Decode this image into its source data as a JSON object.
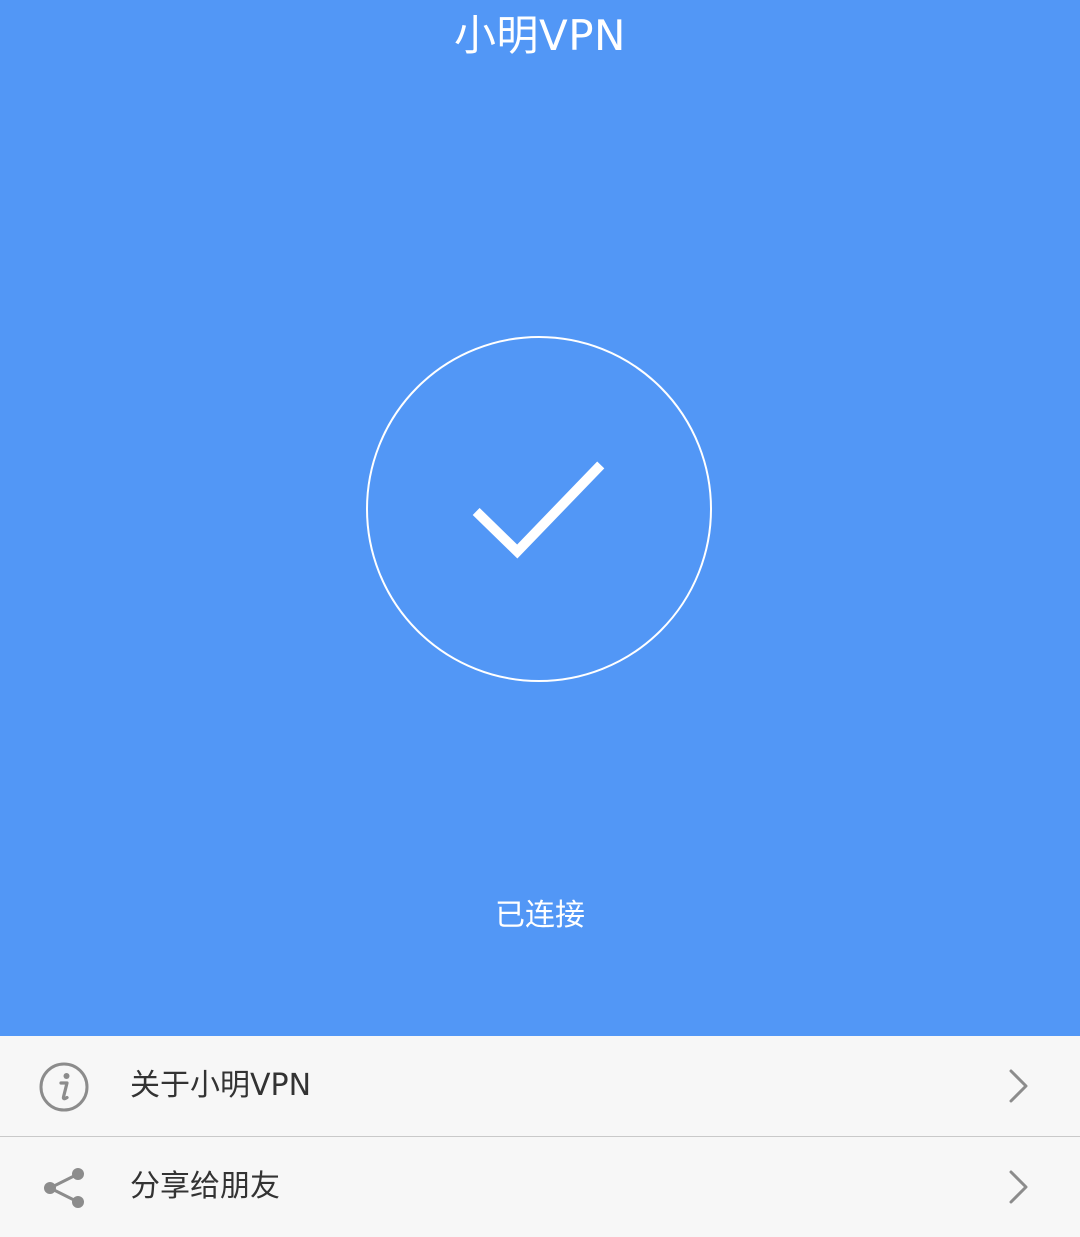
{
  "header": {
    "title": "小明VPN"
  },
  "status": {
    "text": "已连接",
    "icon": "checkmark-icon"
  },
  "menu": {
    "items": [
      {
        "label": "关于小明VPN",
        "icon": "info-icon"
      },
      {
        "label": "分享给朋友",
        "icon": "share-icon"
      }
    ]
  },
  "colors": {
    "primary": "#5297f6",
    "menu_background": "#f7f7f7",
    "text_dark": "#333333",
    "icon_gray": "#8c8c8c"
  }
}
